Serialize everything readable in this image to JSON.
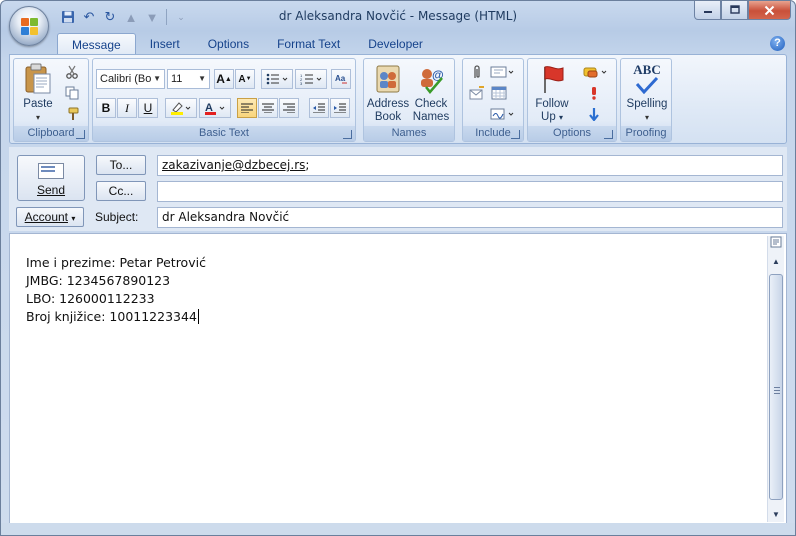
{
  "window": {
    "title": "dr Aleksandra Novčić - Message (HTML)"
  },
  "tabs": [
    "Message",
    "Insert",
    "Options",
    "Format Text",
    "Developer"
  ],
  "ribbon": {
    "clipboard": {
      "label": "Clipboard",
      "paste_label": "Paste"
    },
    "basic_text": {
      "label": "Basic Text",
      "font_name": "Calibri (Bo",
      "font_size": "11"
    },
    "names": {
      "label": "Names",
      "address_book": [
        "Address",
        "Book"
      ],
      "check_names": [
        "Check",
        "Names"
      ]
    },
    "include": {
      "label": "Include"
    },
    "options": {
      "label": "Options",
      "follow_up": [
        "Follow",
        "Up"
      ]
    },
    "proofing": {
      "label": "Proofing",
      "spelling": "Spelling",
      "abc": "ABC"
    }
  },
  "header": {
    "send_label": "Send",
    "to_label": "To...",
    "cc_label": "Cc...",
    "account_label": "Account",
    "subject_label": "Subject:",
    "to_value": "zakazivanje@dzbecej.rs",
    "to_suffix": ";",
    "cc_value": "",
    "subject_value": "dr Aleksandra Novčić"
  },
  "body": {
    "lines": [
      "Ime i prezime: Petar Petrović",
      "JMBG: 1234567890123",
      "LBO: 126000112233",
      "Broj knjižice: 10011223344"
    ]
  },
  "colors": {
    "accent": "#15428b",
    "frame": "#c9d9ee",
    "close": "#c9503a"
  }
}
